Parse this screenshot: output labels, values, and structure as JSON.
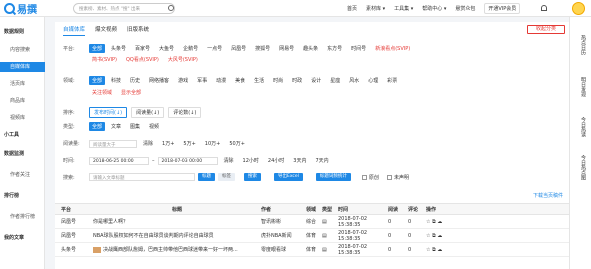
{
  "header": {
    "logo_text": "易撰",
    "search_placeholder": "搜素榜、素材、热点 \"搜\" 出来",
    "nav": [
      "首页",
      "素材库 ▾",
      "工具集 ▾",
      "帮助中心 ▾",
      "悬赏众包",
      "开通VIP会员"
    ]
  },
  "sidebar": {
    "items": [
      "数据规则",
      "内容搜索",
      "自媒体库",
      "活页库",
      "商品库",
      "视频库",
      "小工具",
      "数据监测",
      "作者关注",
      "排行榜",
      "作者排行榜",
      "我的文章"
    ]
  },
  "main": {
    "tabs": [
      "自媒体库",
      "爆文视频",
      "旧版系统"
    ],
    "collect_label": "收起分类",
    "platform_label": "平台:",
    "platforms": [
      "全部",
      "头条号",
      "百家号",
      "大鱼号",
      "企鹅号",
      "一点号",
      "凤凰号",
      "搜狐号",
      "网易号",
      "趣头条",
      "东方号",
      "时间号",
      "新浪看点(SVIP)"
    ],
    "platforms2": [
      "简书(SVIP)",
      "QQ看点(SVIP)",
      "大风号(SVIP)"
    ],
    "domain_label": "领域:",
    "domains": [
      "全部",
      "科技",
      "历史",
      "网络播客",
      "游戏",
      "军事",
      "动漫",
      "美食",
      "生活",
      "时尚",
      "时政",
      "设计",
      "星座",
      "风水",
      "心理",
      "彩票"
    ],
    "links": [
      "关注领域",
      "显示全部"
    ],
    "sort_label": "排序:",
    "sorts": [
      "发布时间(↓)",
      "阅读量(↓)",
      "评论数(↓)"
    ],
    "type_label": "类型:",
    "types": [
      "全部",
      "文章",
      "图集",
      "视频"
    ],
    "read_label": "阅读量:",
    "read_placeholder": "阅读量大于",
    "read_opts": [
      "清除",
      "1万+",
      "5万+",
      "10万+",
      "50万+"
    ],
    "time_label": "时间:",
    "time_from": "2018-06-25 00:00",
    "time_to": "2018-07-03 00:00",
    "time_opts": [
      "清除",
      "12小时",
      "24小时",
      "3天内",
      "7天内"
    ],
    "search_label": "搜索:",
    "search_placeholder": "请输入文章标题",
    "btns": [
      "标题",
      "标签",
      "搜索",
      "导出Excel",
      "标题词频统计"
    ],
    "checks": [
      "原创",
      "未声明"
    ],
    "download": "下载当页稿件",
    "columns": [
      "平台",
      "标题",
      "作者",
      "领域",
      "类型",
      "时间",
      "阅读",
      "评论",
      "操作"
    ],
    "rows": [
      [
        "凤凰号",
        "你是哪里人啊？",
        "智讯彬彬",
        "综合",
        "",
        "2018-07-02 15:38:35",
        "0",
        "0",
        ""
      ],
      [
        "凤凰号",
        "NBA球队股权如何不在自由球员谈判期内评论自由球员",
        "虎扑NBA新闻",
        "体育",
        "",
        "2018-07-02 15:38:35",
        "0",
        "0",
        ""
      ],
      [
        "头条号",
        "决战鹰西部队詹姆，巴西主帅带他巴西球迷带来一好一坏两...",
        "零度眼看球",
        "体育",
        "",
        "2018-07-02 15:38:35",
        "0",
        "0",
        ""
      ]
    ]
  },
  "rightbar": [
    "热点日历",
    "明日发现",
    "今日热读",
    "今日热点图"
  ]
}
